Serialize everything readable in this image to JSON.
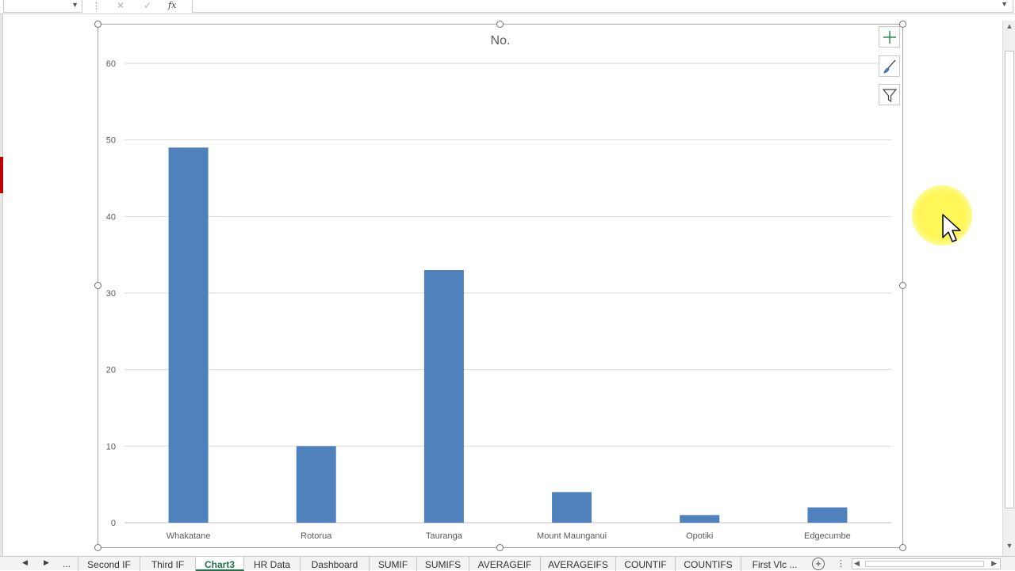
{
  "formula_bar": {
    "name_box_value": "",
    "cancel_glyph": "✕",
    "enter_glyph": "✓",
    "fx_label": "fx",
    "formula_value": ""
  },
  "chart_data": {
    "type": "bar",
    "title": "No.",
    "categories": [
      "Whakatane",
      "Rotorua",
      "Tauranga",
      "Mount Maunganui",
      "Opotiki",
      "Edgecumbe"
    ],
    "values": [
      49,
      10,
      33,
      4,
      1,
      2
    ],
    "ylim": [
      0,
      60
    ],
    "yticks": [
      0,
      10,
      20,
      30,
      40,
      50,
      60
    ],
    "xlabel": "",
    "ylabel": "",
    "grid": true,
    "legend": "none",
    "bar_color": "#4f81bd"
  },
  "chart_tools": {
    "elements_icon": "plus-icon",
    "styles_icon": "brush-icon",
    "filters_icon": "filter-icon"
  },
  "sheet_tabs": {
    "nav_ellipsis": "...",
    "tabs": [
      "Second IF",
      "Third IF",
      "Chart3",
      "HR Data",
      "Dashboard",
      "SUMIF",
      "SUMIFS",
      "AVERAGEIF",
      "AVERAGEIFS",
      "COUNTIF",
      "COUNTIFS",
      "First Vlc ..."
    ],
    "active_tab": "Chart3",
    "add_sheet_glyph": "+",
    "overflow_glyph": "⋮"
  },
  "colors": {
    "accent_green": "#217346",
    "bar_blue": "#4f81bd",
    "cursor_highlight": "#fff44f"
  }
}
